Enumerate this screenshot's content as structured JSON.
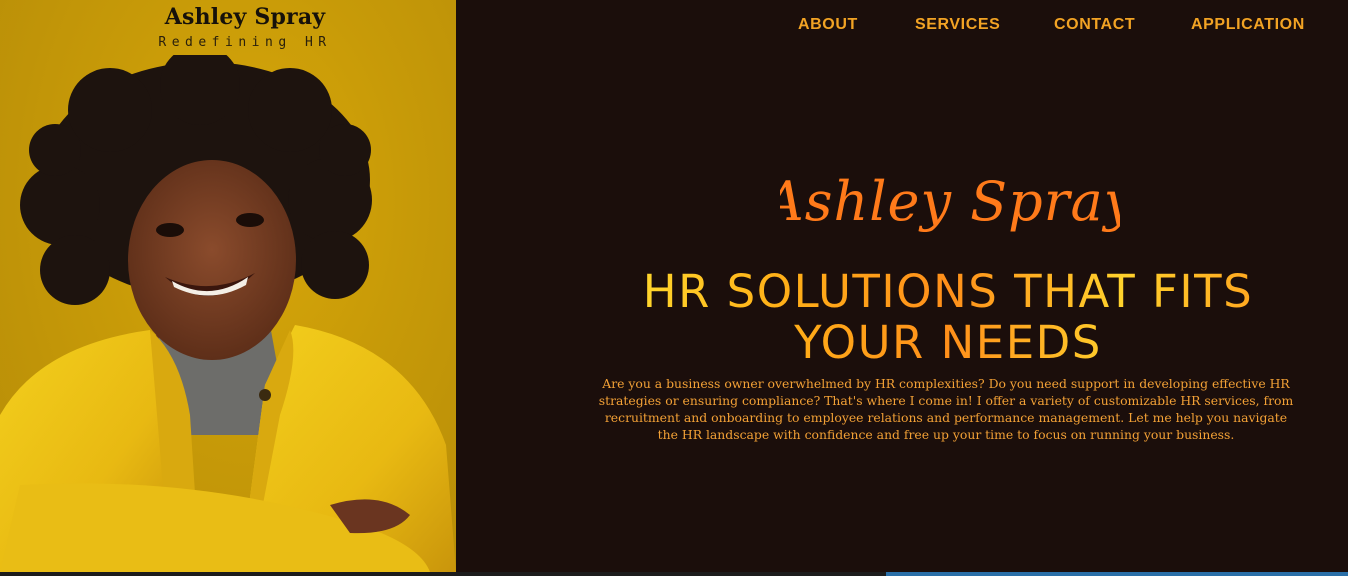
{
  "brand": {
    "name": "Ashley Spray",
    "tagline": "Redefining HR"
  },
  "nav": {
    "items": [
      {
        "label": "ABOUT"
      },
      {
        "label": "SERVICES"
      },
      {
        "label": "CONTACT"
      },
      {
        "label": "APPLICATION"
      }
    ]
  },
  "hero": {
    "script_name": "Ashley Spray",
    "title": "HR SOLUTIONS THAT FITS YOUR NEEDS",
    "body": "Are you a business owner overwhelmed by HR complexities? Do you need support in developing effective HR strategies or ensuring compliance? That's where I come in! I offer a variety of customizable HR services, from recruitment and onboarding to employee relations and performance management. Let me help you navigate the HR landscape with confidence and free up your time to focus on running your business."
  },
  "colors": {
    "background": "#1b0e0b",
    "panel_yellow": "#c79a08",
    "nav": "#f2a324",
    "script": "#ff7a1a",
    "body_text": "#f3a136"
  }
}
